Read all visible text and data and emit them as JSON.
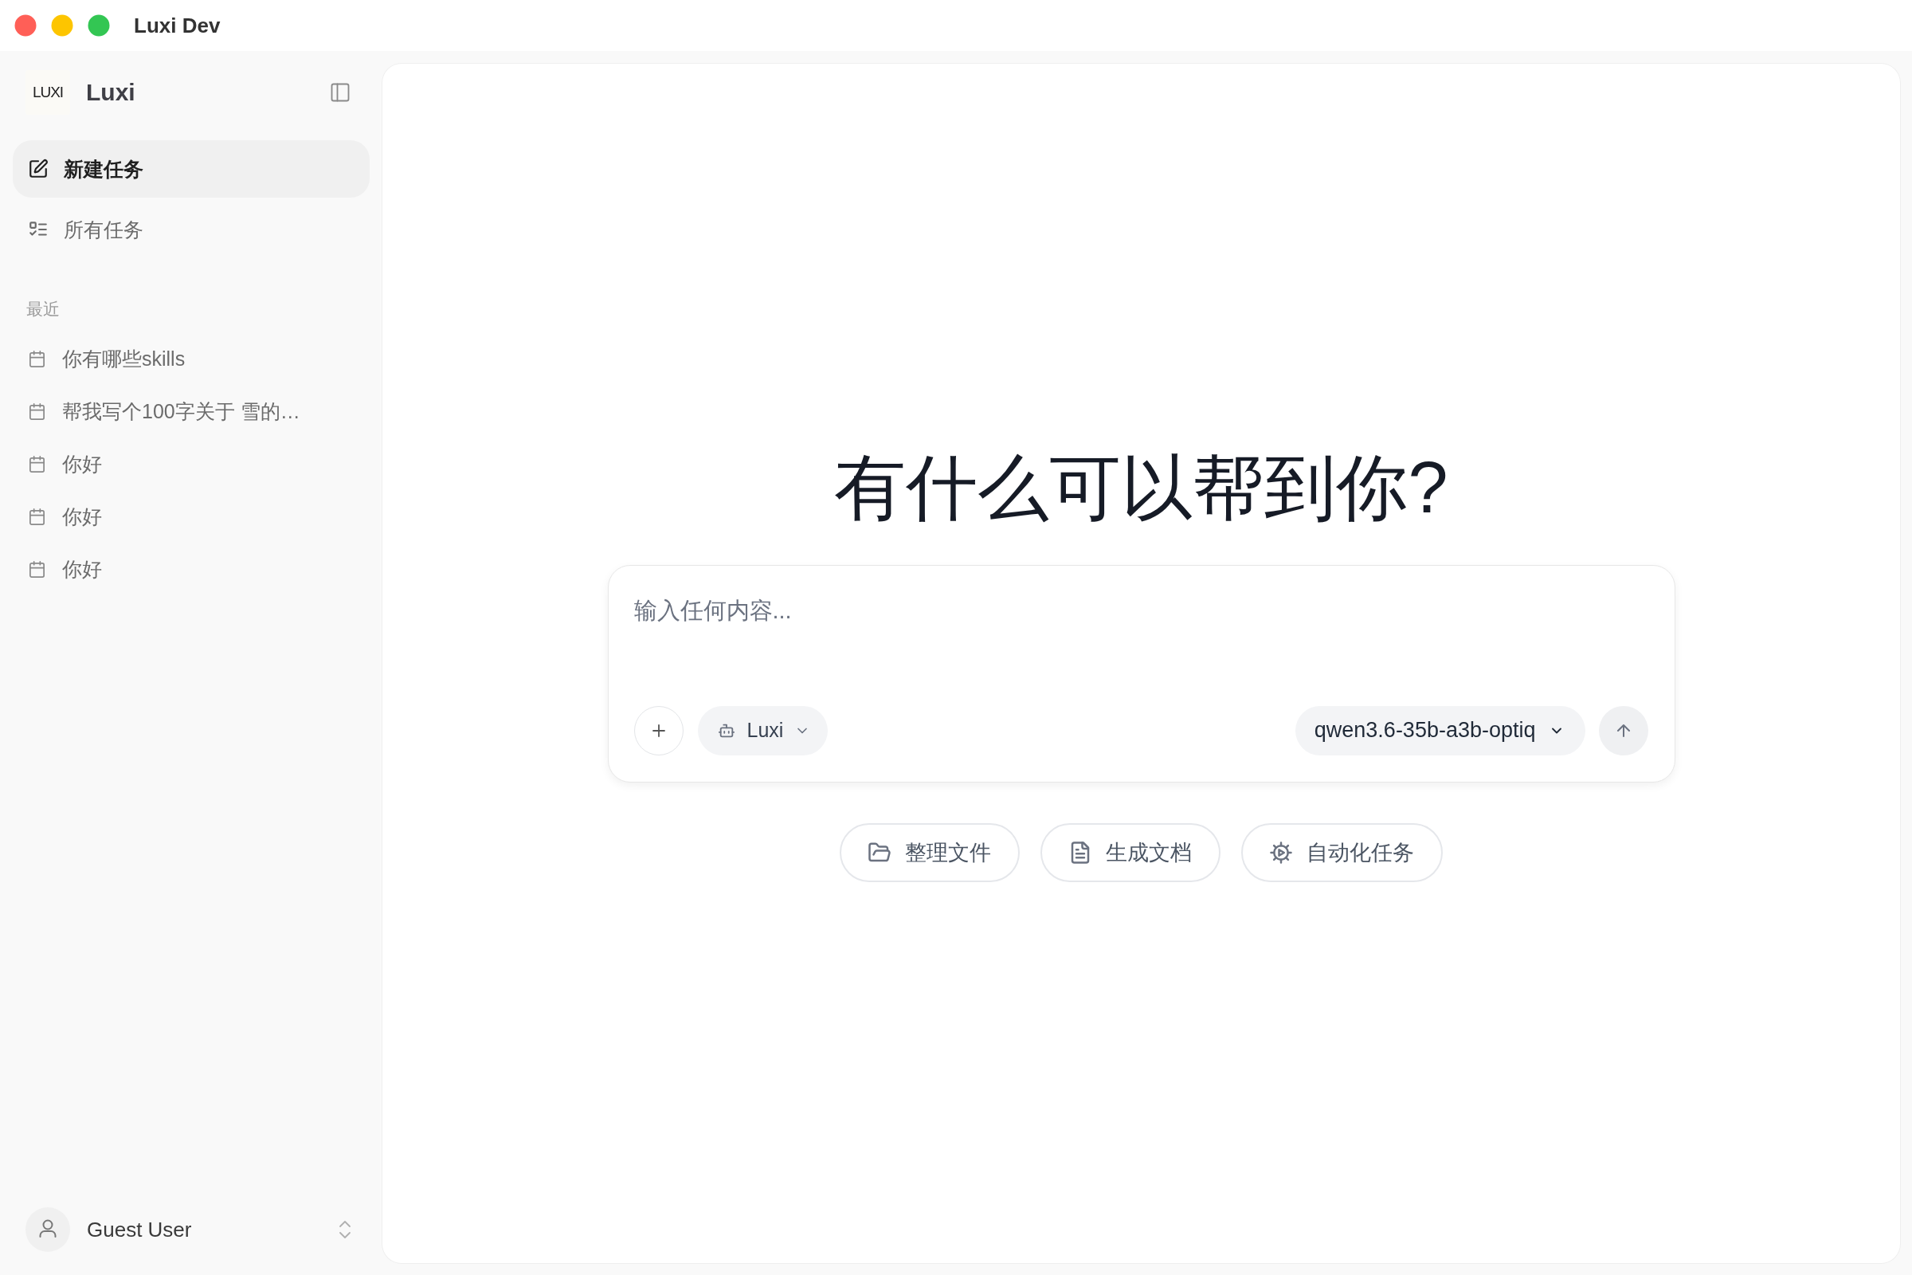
{
  "window": {
    "title": "Luxi Dev"
  },
  "sidebar": {
    "logo": "LUXI",
    "app_name": "Luxi",
    "nav": [
      {
        "kind": "new",
        "label": "新建任务",
        "selected": true
      },
      {
        "kind": "list",
        "label": "所有任务",
        "selected": false
      }
    ],
    "recent": {
      "heading": "最近",
      "items": [
        {
          "label": "你有哪些skills",
          "selected": false
        },
        {
          "label": "帮我写个100字关于 雪的…",
          "selected": false
        },
        {
          "label": "你好",
          "selected": false
        },
        {
          "label": "你好",
          "selected": false
        },
        {
          "label": "你好",
          "selected": false
        }
      ]
    },
    "user": {
      "name": "Guest User"
    }
  },
  "main": {
    "heading": "有什么可以帮到你?",
    "composer": {
      "placeholder": "输入任何内容...",
      "agent": "Luxi",
      "model": "qwen3.6-35b-a3b-optiq"
    },
    "suggestions": [
      {
        "kind": "folder",
        "label": "整理文件"
      },
      {
        "kind": "document",
        "label": "生成文档"
      },
      {
        "kind": "automation",
        "label": "自动化任务"
      }
    ]
  }
}
